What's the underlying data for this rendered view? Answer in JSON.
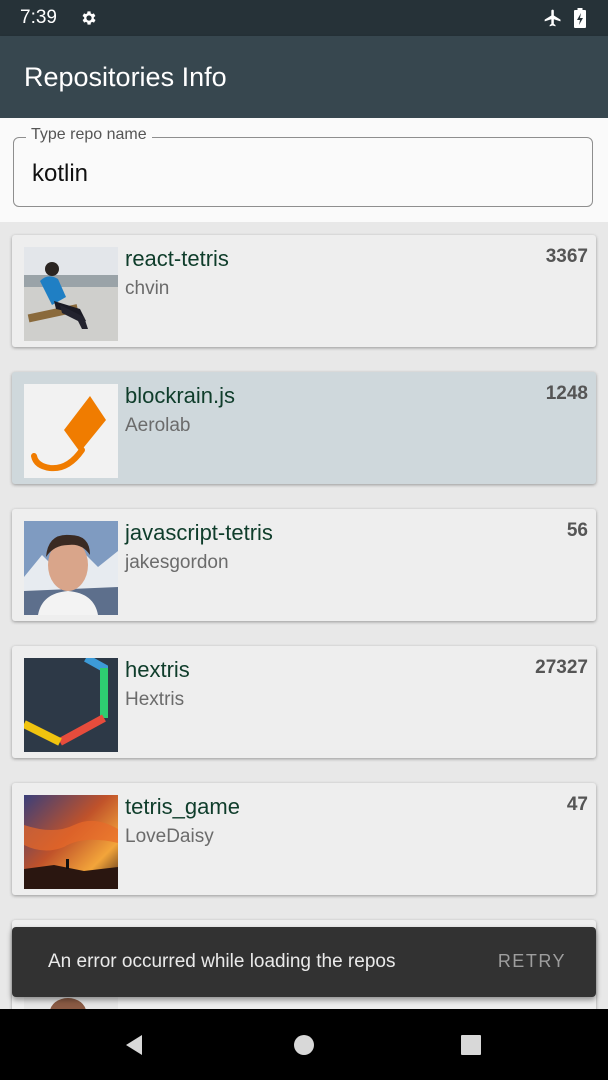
{
  "status_bar": {
    "time": "7:39",
    "icons": [
      "settings-icon",
      "airplane-mode-icon",
      "battery-charging-icon"
    ]
  },
  "app_bar": {
    "title": "Repositories Info",
    "color": "#37474f"
  },
  "search": {
    "label": "Type repo name",
    "value": "kotlin"
  },
  "repos": [
    {
      "name": "react-tetris",
      "owner": "chvin",
      "stars": "3367",
      "avatar": "photo-person-sitting-beach-icon"
    },
    {
      "name": "blockrain.js",
      "owner": "Aerolab",
      "stars": "1248",
      "avatar": "orange-block-logo-icon"
    },
    {
      "name": "javascript-tetris",
      "owner": "jakesgordon",
      "stars": "56",
      "avatar": "photo-man-portrait-icon"
    },
    {
      "name": "hextris",
      "owner": "Hextris",
      "stars": "27327",
      "avatar": "hexagon-logo-icon"
    },
    {
      "name": "tetris_game",
      "owner": "LoveDaisy",
      "stars": "47",
      "avatar": "photo-sunset-sky-icon"
    }
  ],
  "snackbar": {
    "message": "An error occurred while loading the repos",
    "action": "RETRY"
  },
  "nav_bar": {
    "icons": [
      "back-icon",
      "home-icon",
      "recents-icon"
    ]
  },
  "colors": {
    "status_bar": "#263238",
    "selected_card": "#cfd8dc",
    "repo_name": "#0f3d2b"
  }
}
